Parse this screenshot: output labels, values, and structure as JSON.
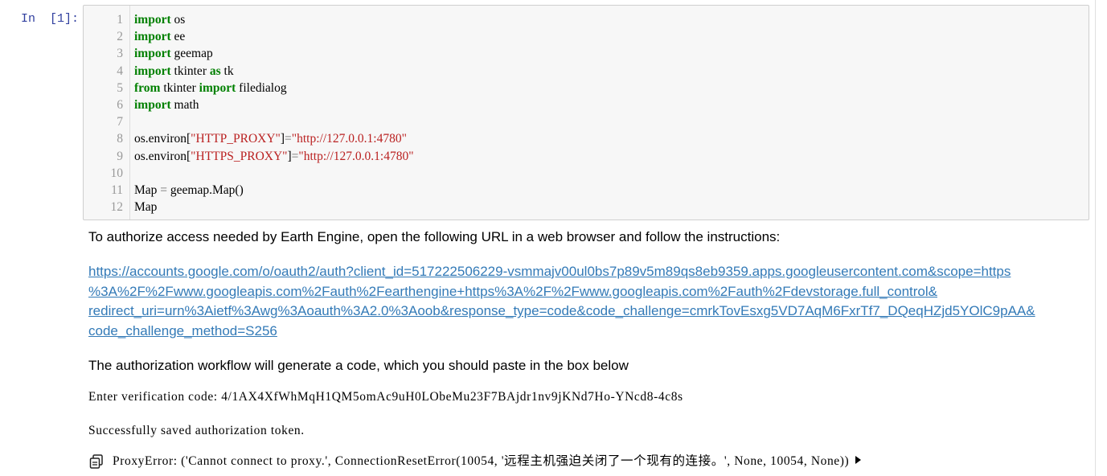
{
  "cell": {
    "prompt": "In  [1]:",
    "code_lines": [
      {
        "n": "1",
        "tokens": [
          {
            "t": "import",
            "c": "kw"
          },
          {
            "t": " os",
            "c": ""
          }
        ]
      },
      {
        "n": "2",
        "tokens": [
          {
            "t": "import",
            "c": "kw"
          },
          {
            "t": " ee",
            "c": ""
          }
        ]
      },
      {
        "n": "3",
        "tokens": [
          {
            "t": "import",
            "c": "kw"
          },
          {
            "t": " geemap",
            "c": ""
          }
        ]
      },
      {
        "n": "4",
        "tokens": [
          {
            "t": "import",
            "c": "kw"
          },
          {
            "t": " tkinter ",
            "c": ""
          },
          {
            "t": "as",
            "c": "kw"
          },
          {
            "t": " tk",
            "c": ""
          }
        ]
      },
      {
        "n": "5",
        "tokens": [
          {
            "t": "from",
            "c": "kw"
          },
          {
            "t": " tkinter ",
            "c": ""
          },
          {
            "t": "import",
            "c": "kw"
          },
          {
            "t": " filedialog",
            "c": ""
          }
        ]
      },
      {
        "n": "6",
        "tokens": [
          {
            "t": "import",
            "c": "kw"
          },
          {
            "t": " math",
            "c": ""
          }
        ]
      },
      {
        "n": "7",
        "tokens": []
      },
      {
        "n": "8",
        "tokens": [
          {
            "t": "os.environ[",
            "c": ""
          },
          {
            "t": "\"HTTP_PROXY\"",
            "c": "str"
          },
          {
            "t": "]",
            "c": ""
          },
          {
            "t": "=",
            "c": "op"
          },
          {
            "t": "\"http://127.0.0.1:4780\"",
            "c": "str"
          }
        ]
      },
      {
        "n": "9",
        "tokens": [
          {
            "t": "os.environ[",
            "c": ""
          },
          {
            "t": "\"HTTPS_PROXY\"",
            "c": "str"
          },
          {
            "t": "]",
            "c": ""
          },
          {
            "t": "=",
            "c": "op"
          },
          {
            "t": "\"http://127.0.0.1:4780\"",
            "c": "str"
          }
        ]
      },
      {
        "n": "10",
        "tokens": []
      },
      {
        "n": "11",
        "tokens": [
          {
            "t": "Map ",
            "c": ""
          },
          {
            "t": "=",
            "c": "op"
          },
          {
            "t": " geemap.Map()",
            "c": ""
          }
        ]
      },
      {
        "n": "12",
        "tokens": [
          {
            "t": "Map",
            "c": ""
          }
        ]
      }
    ]
  },
  "output": {
    "intro": "To authorize access needed by Earth Engine, open the following URL in a web browser and follow the instructions:",
    "auth_url_lines": [
      "https://accounts.google.com/o/oauth2/auth?client_id=517222506229-vsmmajv00ul0bs7p89v5m89qs8eb9359.apps.googleusercontent.com&scope=https",
      "%3A%2F%2Fwww.googleapis.com%2Fauth%2Fearthengine+https%3A%2F%2Fwww.googleapis.com%2Fauth%2Fdevstorage.full_control&",
      "redirect_uri=urn%3Aietf%3Awg%3Aoauth%3A2.0%3Aoob&response_type=code&code_challenge=cmrkTovEsxg5VD7AqM6FxrTf7_DQeqHZjd5YOlC9pAA&",
      "code_challenge_method=S256"
    ],
    "workflow_note": "The authorization workflow will generate a code, which you should paste in the box below",
    "verification": "Enter verification code: 4/1AX4XfWhMqH1QM5omAc9uH0LObeMu23F7BAjdr1nv9jKNd7Ho-YNcd8-4c8s",
    "saved": "Successfully saved authorization token.",
    "error": "ProxyError: ('Cannot connect to proxy.', ConnectionResetError(10054, '远程主机强迫关闭了一个现有的连接。', None, 10054, None))"
  },
  "icons": {
    "copy": "copy-icon",
    "expand": "triangle-right-icon"
  }
}
